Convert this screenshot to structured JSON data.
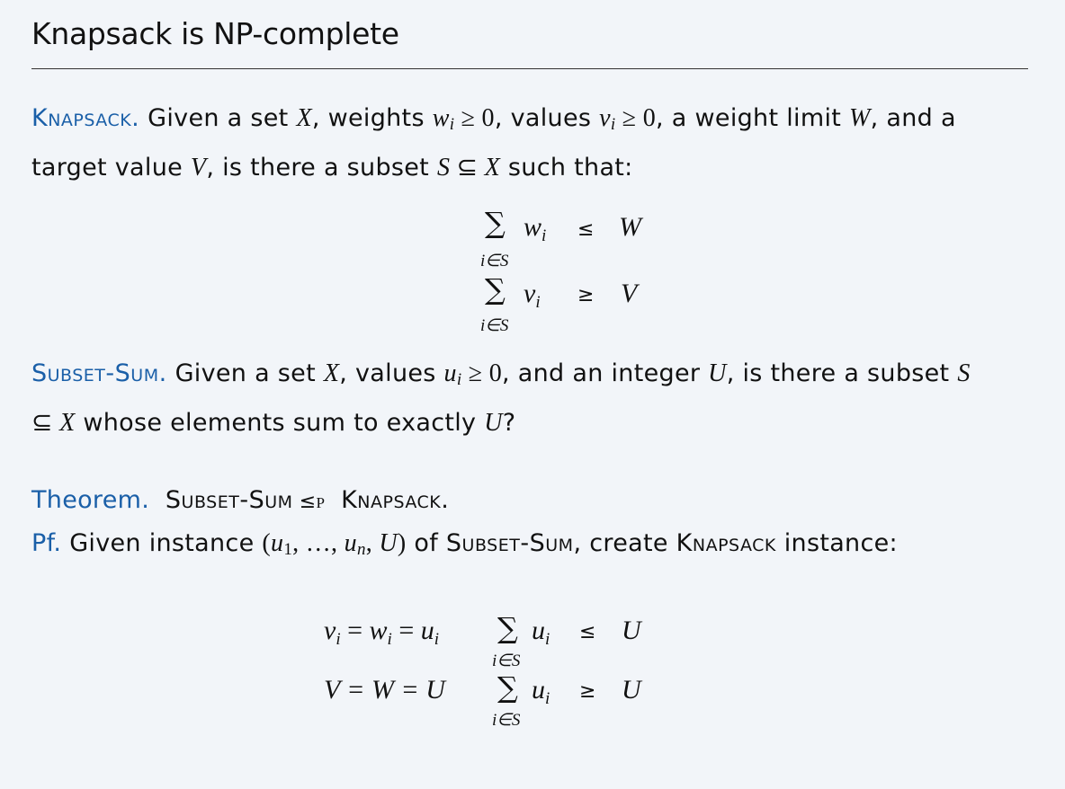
{
  "title": "Knapsack is NP-complete",
  "knapsack": {
    "name": "Knapsack.",
    "t1": " Given a set ",
    "X": "X",
    "t2": ", weights ",
    "w": "w",
    "i": "i",
    "geq0": " ≥ 0",
    "t3": ", values ",
    "v": "v",
    "t4": ", a weight limit ",
    "W": "W",
    "t5": ", and a target value ",
    "V": "V",
    "t6": ", is there a subset ",
    "S": "S",
    "subseteq": " ⊆ ",
    "t7": " such that:"
  },
  "knapsack_display": {
    "sum": "∑",
    "under": "i∈S",
    "w_term": "w",
    "v_term": "v",
    "idx": "i",
    "leq": "≤",
    "geq": "≥",
    "W": "W",
    "V": "V"
  },
  "subsetsum": {
    "name": "Subset-Sum.",
    "t1": " Given a set ",
    "X": "X",
    "t2": ", values ",
    "u": "u",
    "i": "i",
    "geq0": " ≥ 0",
    "t3": ", and an integer ",
    "U": "U",
    "t4": ", is there a subset ",
    "S": "S",
    "subseteq": "⊆ ",
    "t5": " whose elements sum to exactly ",
    "t6": "?"
  },
  "theorem": {
    "label": "Theorem.",
    "a": "Subset-Sum",
    "rel": " ≤",
    "p": "P",
    "b": "Knapsack",
    "end": "."
  },
  "proof": {
    "label": "Pf.",
    "t1": " Given instance ",
    "inst_open": "(",
    "u": "u",
    "one": "1",
    "dots": ", …, ",
    "n": "n",
    "comma": ", ",
    "U": "U",
    "inst_close": ")",
    "t2": " of ",
    "a": "Subset-Sum",
    "t3": ", create ",
    "b": "Knapsack",
    "t4": " instance:"
  },
  "reduction": {
    "eq1_v": "v",
    "eq1_w": "w",
    "eq1_u": "u",
    "idx": "i",
    "eq_sign": " = ",
    "eq2": "V = W = U",
    "sum": "∑",
    "under": "i∈S",
    "term": "u",
    "leq": "≤",
    "geq": "≥",
    "U": "U"
  }
}
